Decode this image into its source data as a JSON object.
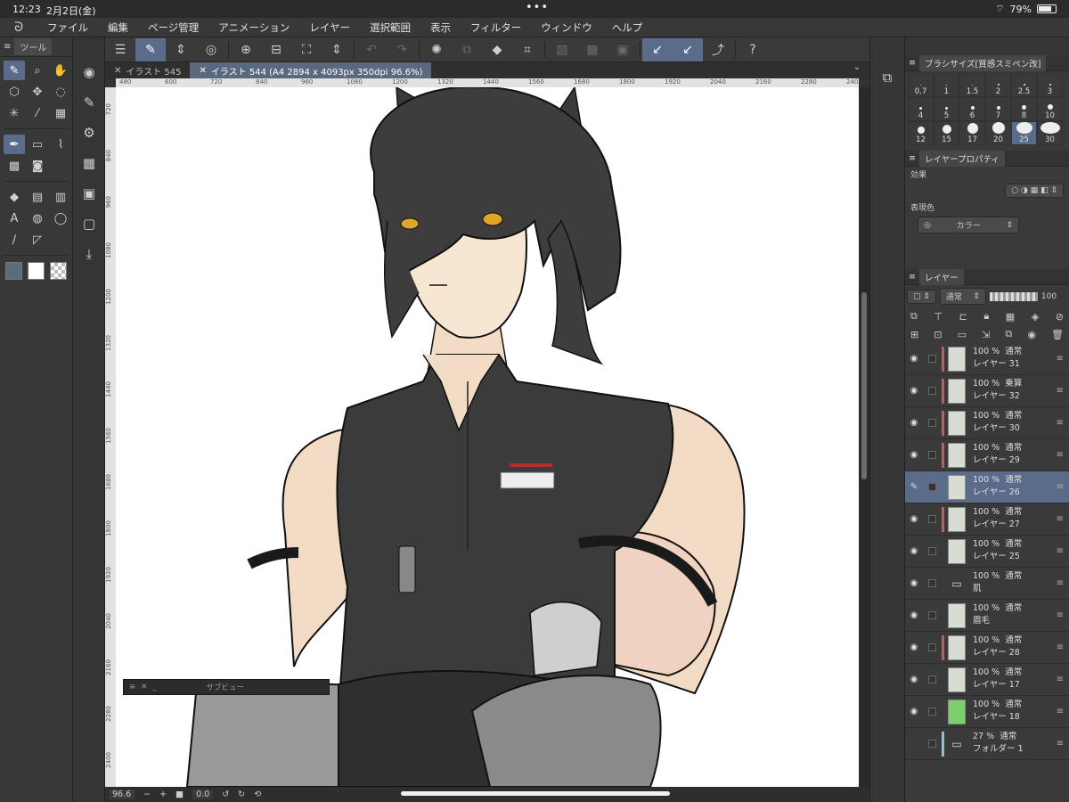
{
  "status": {
    "time": "12:23",
    "date": "2月2日(金)",
    "battery": "79%"
  },
  "menu": [
    "ファイル",
    "編集",
    "ページ管理",
    "アニメーション",
    "レイヤー",
    "選択範囲",
    "表示",
    "フィルター",
    "ウィンドウ",
    "ヘルプ"
  ],
  "tool_panel": {
    "title": "ツール"
  },
  "tabs": [
    {
      "label": "イラスト 545",
      "active": false
    },
    {
      "label": "イラスト 544 (A4 2894 x 4093px 350dpi 96.6%)",
      "active": true
    }
  ],
  "ruler_top": [
    "480",
    "600",
    "720",
    "840",
    "960",
    "1080",
    "1200",
    "1320",
    "1440",
    "1560",
    "1680",
    "1800",
    "1920",
    "2040",
    "2160",
    "2280",
    "240"
  ],
  "ruler_left": [
    "720",
    "840",
    "960",
    "1080",
    "1200",
    "1320",
    "1440",
    "1560",
    "1680",
    "1800",
    "1920",
    "2040",
    "2160",
    "2280",
    "2400"
  ],
  "subview": {
    "title": "サブビュー"
  },
  "bottom": {
    "zoom": "96.6",
    "rotation": "0.0"
  },
  "brush_panel": {
    "title": "ブラシサイズ[質感スミペン改]",
    "sizes": [
      {
        "label": "0.7",
        "dot": 1
      },
      {
        "label": "1",
        "dot": 1
      },
      {
        "label": "1.5",
        "dot": 1
      },
      {
        "label": "2",
        "dot": 2
      },
      {
        "label": "2.5",
        "dot": 2
      },
      {
        "label": "3",
        "dot": 2
      },
      {
        "label": "4",
        "dot": 3
      },
      {
        "label": "5",
        "dot": 3
      },
      {
        "label": "6",
        "dot": 4
      },
      {
        "label": "7",
        "dot": 4
      },
      {
        "label": "8",
        "dot": 5
      },
      {
        "label": "10",
        "dot": 6
      },
      {
        "label": "12",
        "dot": 8
      },
      {
        "label": "15",
        "dot": 10
      },
      {
        "label": "17",
        "dot": 12
      },
      {
        "label": "20",
        "dot": 14
      },
      {
        "label": "25",
        "dot": 18,
        "selected": true
      },
      {
        "label": "30",
        "dot": 22
      }
    ]
  },
  "layer_props": {
    "title": "レイヤープロパティ",
    "effect_label": "効果",
    "color_label": "表現色",
    "color_value": "カラー"
  },
  "layers_panel": {
    "title": "レイヤー",
    "blend_mode": "通常",
    "opacity": "100",
    "items": [
      {
        "pct": "100 %",
        "mode": "通常",
        "name": "レイヤー 31",
        "mark": "#c45b5b",
        "selected": false,
        "visible": true
      },
      {
        "pct": "100 %",
        "mode": "乗算",
        "name": "レイヤー 32",
        "mark": "#c45b5b",
        "selected": false,
        "visible": true
      },
      {
        "pct": "100 %",
        "mode": "通常",
        "name": "レイヤー 30",
        "mark": "#c45b5b",
        "selected": false,
        "visible": true
      },
      {
        "pct": "100 %",
        "mode": "通常",
        "name": "レイヤー 29",
        "mark": "#c45b5b",
        "selected": false,
        "visible": true
      },
      {
        "pct": "100 %",
        "mode": "通常",
        "name": "レイヤー 26",
        "mark": "",
        "selected": true,
        "visible": true
      },
      {
        "pct": "100 %",
        "mode": "通常",
        "name": "レイヤー 27",
        "mark": "#c45b5b",
        "selected": false,
        "visible": true
      },
      {
        "pct": "100 %",
        "mode": "通常",
        "name": "レイヤー 25",
        "mark": "",
        "selected": false,
        "visible": true
      },
      {
        "pct": "100 %",
        "mode": "通常",
        "name": "肌",
        "mark": "",
        "selected": false,
        "visible": true,
        "folder": true
      },
      {
        "pct": "100 %",
        "mode": "通常",
        "name": "眉毛",
        "mark": "",
        "selected": false,
        "visible": true
      },
      {
        "pct": "100 %",
        "mode": "通常",
        "name": "レイヤー 28",
        "mark": "#c45b5b",
        "selected": false,
        "visible": true
      },
      {
        "pct": "100 %",
        "mode": "通常",
        "name": "レイヤー 17",
        "mark": "",
        "selected": false,
        "visible": true
      },
      {
        "pct": "100 %",
        "mode": "通常",
        "name": "レイヤー 18",
        "mark": "",
        "selected": false,
        "visible": true,
        "green": true
      },
      {
        "pct": "27 %",
        "mode": "通常",
        "name": "フォルダー 1",
        "mark": "#7ec8d8",
        "selected": false,
        "visible": false,
        "folder": true
      }
    ]
  },
  "colors": {
    "accent": "#5b6c8b",
    "panel": "#3a3a3a",
    "canvas": "#ffffff",
    "red_mark": "#c45b5b"
  }
}
